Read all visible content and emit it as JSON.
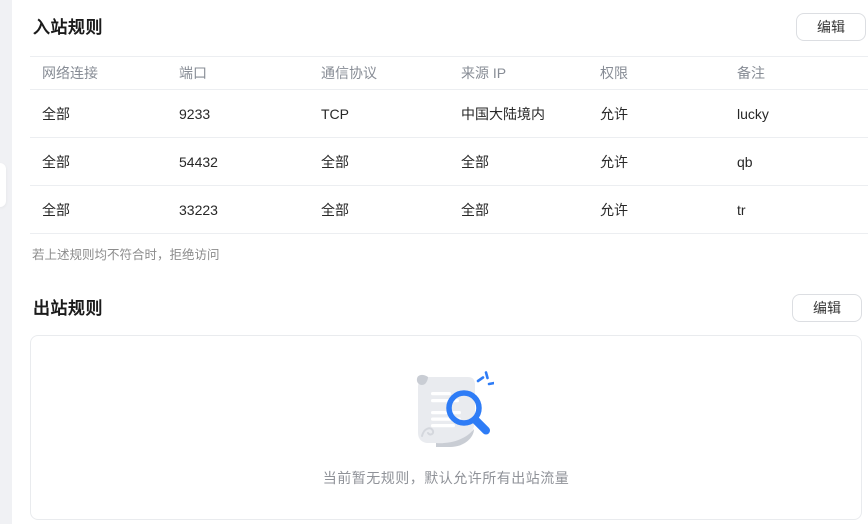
{
  "inbound": {
    "title": "入站规则",
    "edit_label": "编辑",
    "columns": [
      "网络连接",
      "端口",
      "通信协议",
      "来源 IP",
      "权限",
      "备注"
    ],
    "rows": [
      [
        "全部",
        "9233",
        "TCP",
        "中国大陆境内",
        "允许",
        "lucky"
      ],
      [
        "全部",
        "54432",
        "全部",
        "全部",
        "允许",
        "qb"
      ],
      [
        "全部",
        "33223",
        "全部",
        "全部",
        "允许",
        "tr"
      ]
    ],
    "fallback_note": "若上述规则均不符合时，拒绝访问"
  },
  "outbound": {
    "title": "出站规则",
    "edit_label": "编辑",
    "empty_text": "当前暂无规则，默认允许所有出站流量",
    "empty_icon": "document-search-icon"
  },
  "colors": {
    "accent_blue": "#2E7CF6",
    "icon_doc_grey": "#E9EBEF",
    "icon_doc_shade": "#C9CDD4",
    "divider": "#ECEEF1"
  }
}
